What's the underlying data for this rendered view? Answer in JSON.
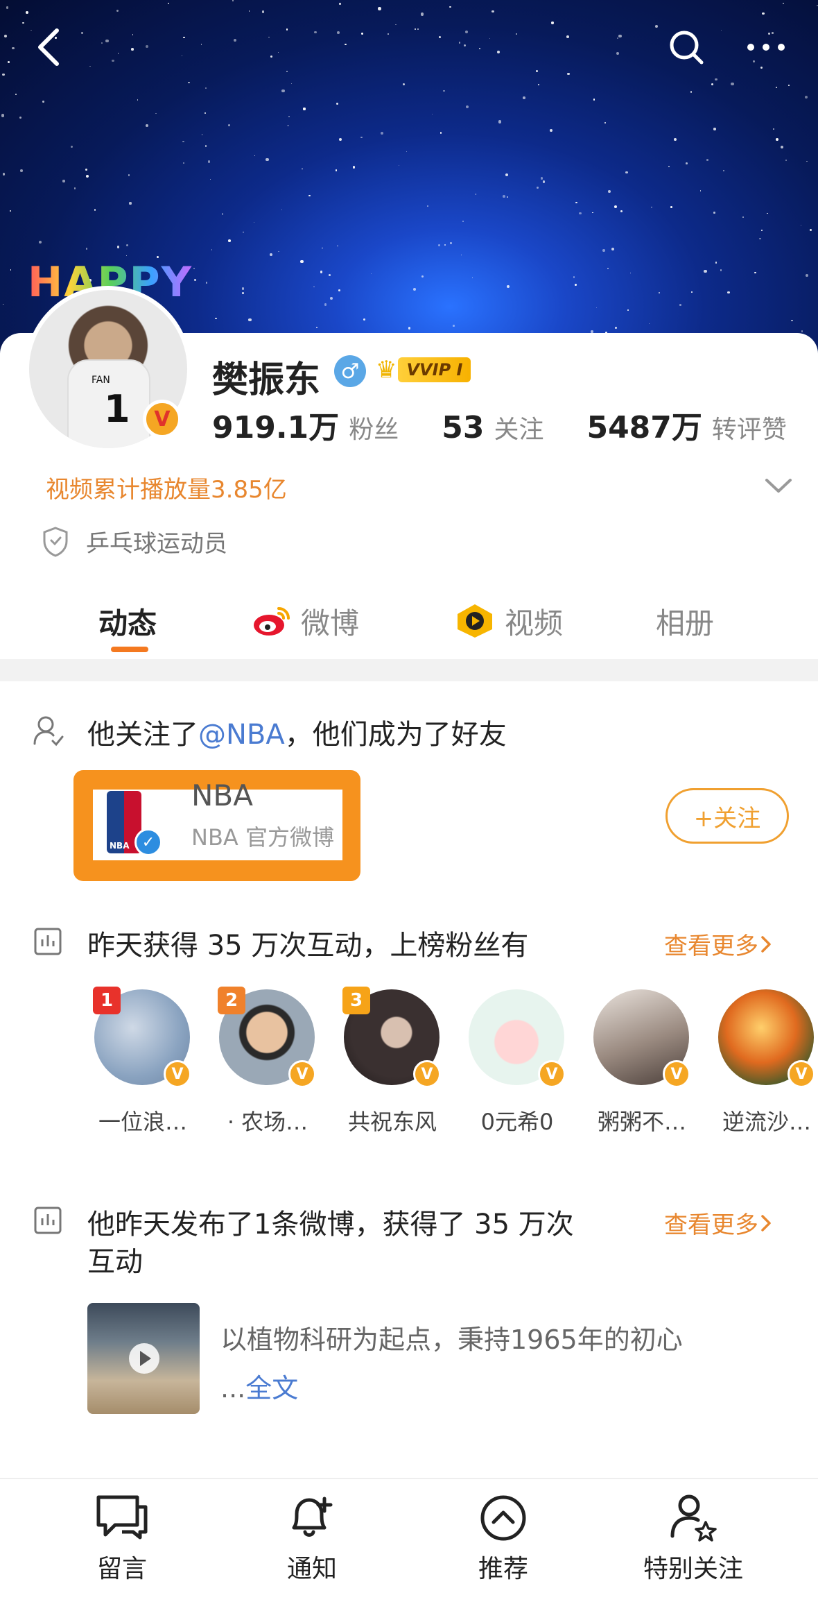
{
  "profile": {
    "banner_sticker": "HAPPY",
    "shirt_name": "FAN",
    "shirt_number": "1",
    "name": "樊振东",
    "gender_symbol": "♂",
    "vip_label": "VVIP I",
    "stats": [
      {
        "value": "919.1万",
        "label": "粉丝"
      },
      {
        "value": "53",
        "label": "关注"
      },
      {
        "value": "5487万",
        "label": "转评赞"
      }
    ],
    "play_count": "视频累计播放量3.85亿",
    "occupation": "乒乓球运动员"
  },
  "tabs": [
    {
      "label": "动态",
      "active": true
    },
    {
      "label": "微博",
      "active": false
    },
    {
      "label": "视频",
      "active": false
    },
    {
      "label": "相册",
      "active": false
    }
  ],
  "feed": {
    "follow_event": {
      "prefix": "他关注了",
      "mention": "@NBA",
      "suffix": "，他们成为了好友",
      "account_name": "NBA",
      "account_desc": "NBA 官方微博",
      "logo_text": "NBA",
      "follow_button": "+关注"
    },
    "interaction": {
      "title": "昨天获得 35 万次互动，上榜粉丝有",
      "more": "查看更多",
      "fans": [
        {
          "rank": "1",
          "name": "一位浪…"
        },
        {
          "rank": "2",
          "name": "· 农场…"
        },
        {
          "rank": "3",
          "name": "共祝东风"
        },
        {
          "rank": "",
          "name": "0元希0"
        },
        {
          "rank": "",
          "name": "粥粥不…"
        },
        {
          "rank": "",
          "name": "逆流沙…"
        }
      ]
    },
    "posts_summary": {
      "title_line1": "他昨天发布了1条微博，获得了 35 万次",
      "title_line2": "互动",
      "more": "查看更多",
      "post_text": "以植物科研为起点，秉持1965年的初心",
      "post_ellipsis": "...",
      "post_fulltext": "全文"
    }
  },
  "bottom_bar": [
    {
      "label": "留言"
    },
    {
      "label": "通知"
    },
    {
      "label": "推荐"
    },
    {
      "label": "特别关注"
    }
  ],
  "colors": {
    "accent_orange": "#f47920",
    "link_orange": "#e8872f",
    "link_blue": "#4a7bd1"
  }
}
